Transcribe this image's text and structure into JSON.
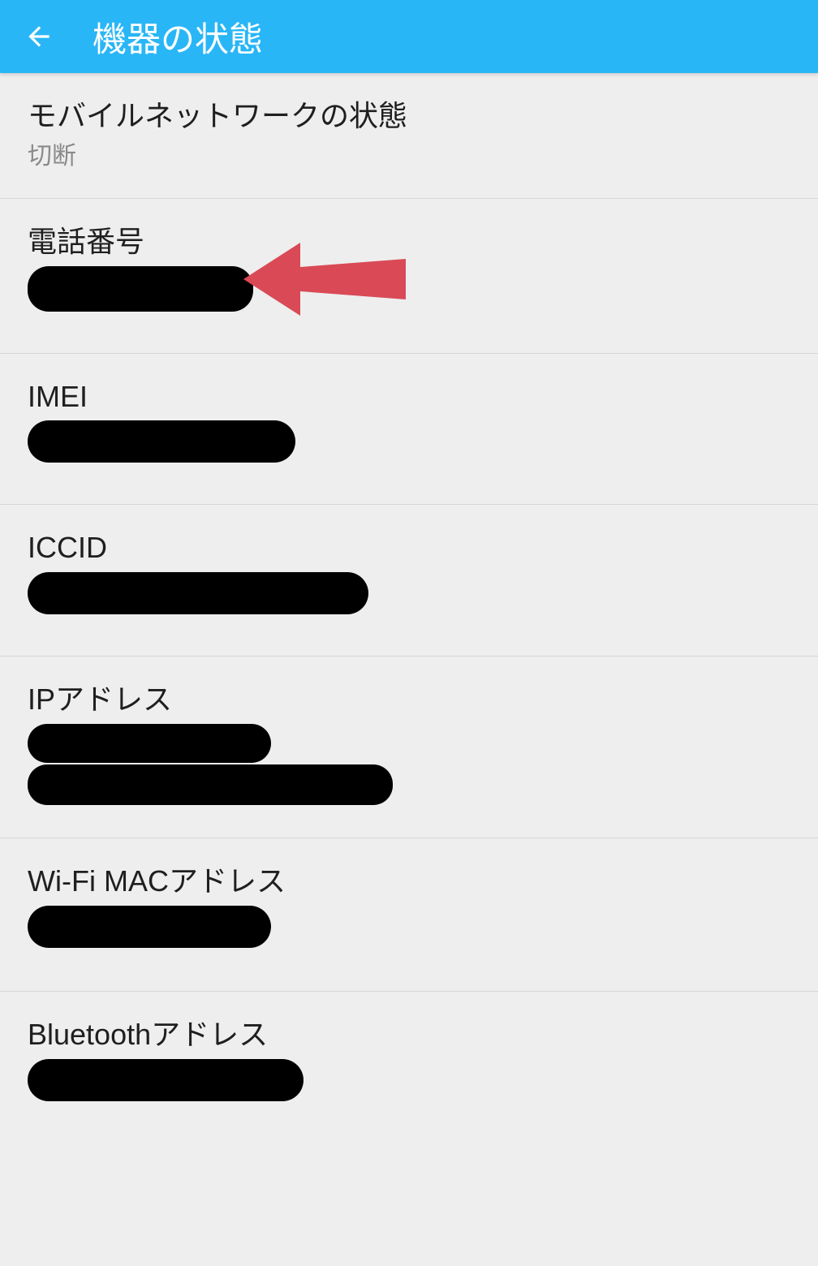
{
  "header": {
    "title": "機器の状態"
  },
  "rows": {
    "network_status": {
      "label": "モバイルネットワークの状態",
      "value": "切断"
    },
    "phone_number": {
      "label": "電話番号"
    },
    "imei": {
      "label": "IMEI"
    },
    "iccid": {
      "label": "ICCID"
    },
    "ip_address": {
      "label": "IPアドレス"
    },
    "wifi_mac": {
      "label": "Wi-Fi MACアドレス"
    },
    "bluetooth": {
      "label": "Bluetoothアドレス"
    }
  }
}
